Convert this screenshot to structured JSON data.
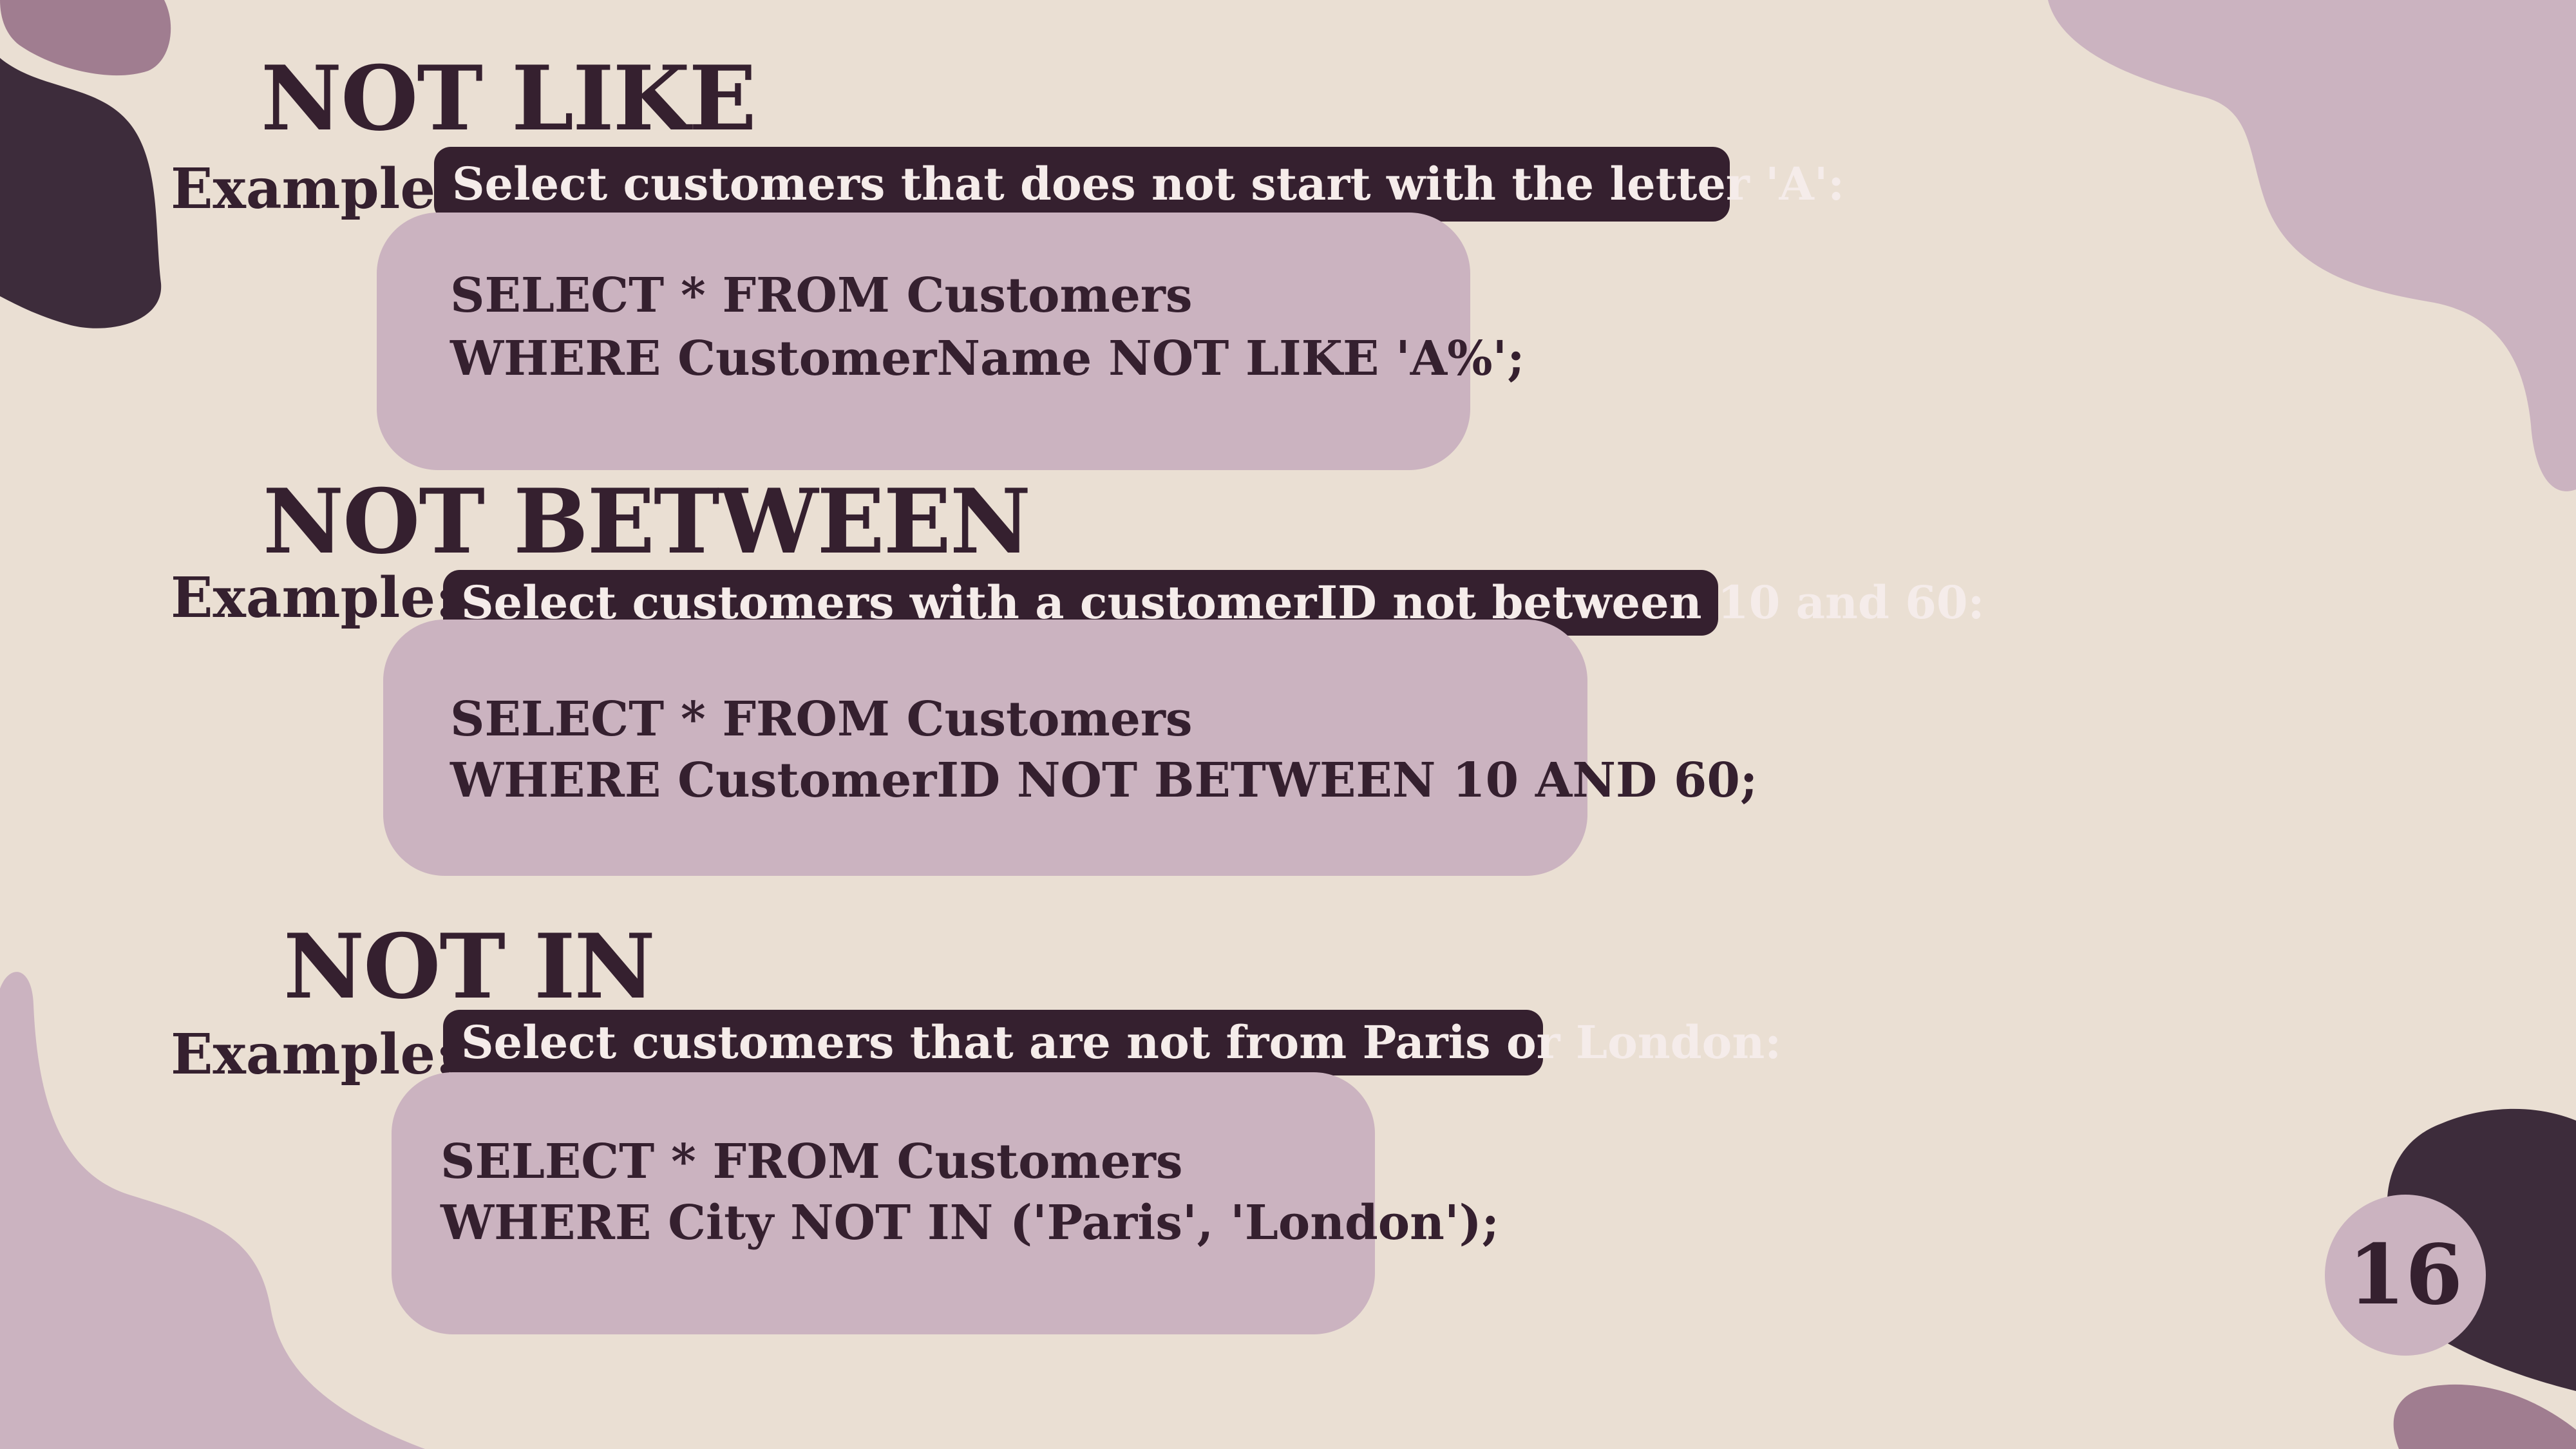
{
  "colors": {
    "background": "#eadfd3",
    "dark": "#35202f",
    "mauve": "#cbb3c0",
    "dusty_rose": "#a07d90"
  },
  "sections": [
    {
      "heading": "NOT LIKE",
      "example_label": "Example:",
      "description": "Select customers that does not start with the letter 'A':",
      "code": [
        "SELECT * FROM Customers",
        "WHERE CustomerName NOT LIKE 'A%';"
      ]
    },
    {
      "heading": "NOT BETWEEN",
      "example_label": "Example:",
      "description": "Select customers with a customerID not between 10 and 60:",
      "code": [
        "SELECT * FROM Customers",
        "WHERE CustomerID NOT BETWEEN 10 AND 60;"
      ]
    },
    {
      "heading": "NOT IN",
      "example_label": "Example:",
      "description": "Select customers that are not from Paris or London:",
      "code": [
        "SELECT * FROM Customers",
        "WHERE City NOT IN ('Paris', 'London');"
      ]
    }
  ],
  "page_number": "16"
}
